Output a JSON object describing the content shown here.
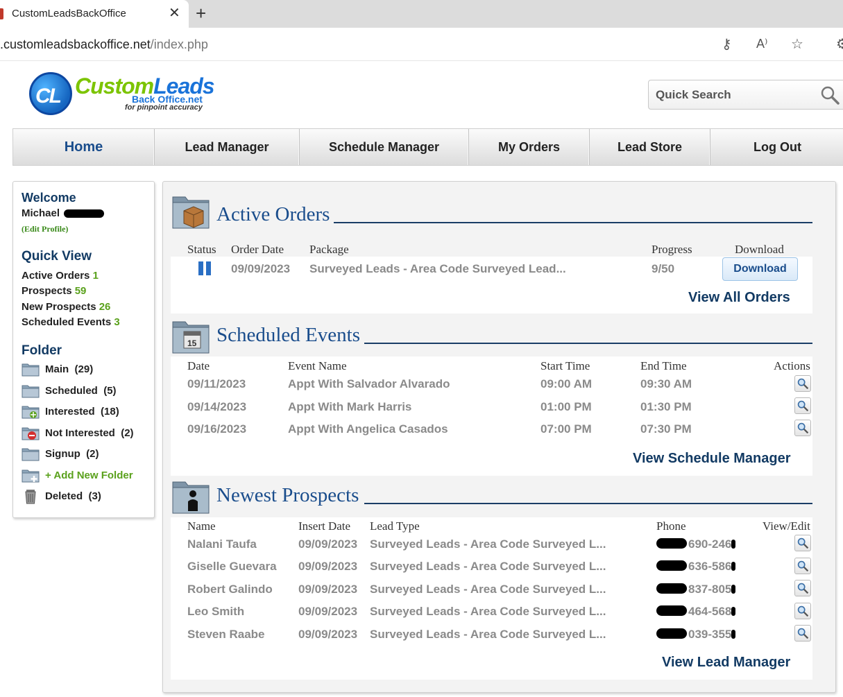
{
  "browser": {
    "tab_title": "CustomLeadsBackOffice",
    "url_host": ".customleadsbackoffice.net",
    "url_path": "/index.php"
  },
  "logo": {
    "initials": "CL",
    "name_part1": "Custom",
    "name_part2": "Leads",
    "subtitle": "Back Office.net",
    "tagline": "for pinpoint accuracy"
  },
  "search": {
    "placeholder": "Quick Search"
  },
  "nav": [
    {
      "label": "Home",
      "active": true
    },
    {
      "label": "Lead Manager"
    },
    {
      "label": "Schedule Manager"
    },
    {
      "label": "My Orders"
    },
    {
      "label": "Lead Store"
    },
    {
      "label": "Log Out"
    }
  ],
  "sidebar": {
    "welcome_heading": "Welcome",
    "user_name": "Michael",
    "edit_profile": "(Edit Profile)",
    "quick_view_heading": "Quick View",
    "quick_view": [
      {
        "label": "Active Orders",
        "count": "1"
      },
      {
        "label": "Prospects",
        "count": "59"
      },
      {
        "label": "New Prospects",
        "count": "26"
      },
      {
        "label": "Scheduled Events",
        "count": "3"
      }
    ],
    "folder_heading": "Folder",
    "folders": [
      {
        "label": "Main",
        "count": "(29)",
        "icon": "folder-icon"
      },
      {
        "label": "Scheduled",
        "count": "(5)",
        "icon": "folder-icon"
      },
      {
        "label": "Interested",
        "count": "(18)",
        "icon": "folder-interested-icon"
      },
      {
        "label": "Not Interested",
        "count": "(2)",
        "icon": "folder-not-interested-icon"
      },
      {
        "label": "Signup",
        "count": "(2)",
        "icon": "folder-icon"
      },
      {
        "label": "+ Add New Folder",
        "count": "",
        "icon": "folder-add-icon"
      },
      {
        "label": "Deleted",
        "count": "(3)",
        "icon": "trash-icon"
      }
    ]
  },
  "active_orders": {
    "title": "Active Orders",
    "headers": [
      "Status",
      "Order Date",
      "Package",
      "Progress",
      "Download"
    ],
    "rows": [
      {
        "status_icon": "pause-icon",
        "order_date": "09/09/2023",
        "package": "Surveyed Leads - Area Code Surveyed Lead...",
        "progress": "9/50",
        "download_label": "Download"
      }
    ],
    "view_all": "View All Orders"
  },
  "scheduled_events": {
    "title": "Scheduled Events",
    "headers": [
      "Date",
      "Event Name",
      "Start Time",
      "End Time",
      "Actions"
    ],
    "rows": [
      {
        "date": "09/11/2023",
        "event": "Appt With Salvador Alvarado",
        "start": "09:00 AM",
        "end": "09:30 AM"
      },
      {
        "date": "09/14/2023",
        "event": "Appt With Mark Harris",
        "start": "01:00 PM",
        "end": "01:30 PM"
      },
      {
        "date": "09/16/2023",
        "event": "Appt With Angelica Casados",
        "start": "07:00 PM",
        "end": "07:30 PM"
      }
    ],
    "view_all": "View Schedule Manager"
  },
  "newest_prospects": {
    "title": "Newest Prospects",
    "headers": [
      "Name",
      "Insert Date",
      "Lead Type",
      "Phone",
      "View/Edit"
    ],
    "rows": [
      {
        "name": "Nalani Taufa",
        "date": "09/09/2023",
        "lead_type": "Surveyed Leads - Area Code Surveyed L...",
        "phone": "690-246"
      },
      {
        "name": "Giselle Guevara",
        "date": "09/09/2023",
        "lead_type": "Surveyed Leads - Area Code Surveyed L...",
        "phone": "636-586"
      },
      {
        "name": "Robert Galindo",
        "date": "09/09/2023",
        "lead_type": "Surveyed Leads - Area Code Surveyed L...",
        "phone": "837-805"
      },
      {
        "name": "Leo Smith",
        "date": "09/09/2023",
        "lead_type": "Surveyed Leads - Area Code Surveyed L...",
        "phone": "464-568"
      },
      {
        "name": "Steven Raabe",
        "date": "09/09/2023",
        "lead_type": "Surveyed Leads - Area Code Surveyed L...",
        "phone": "039-355"
      }
    ],
    "view_all": "View Lead Manager"
  },
  "colors": {
    "heading_navy": "#123a63",
    "link_blue": "#1a4d8c",
    "count_green": "#5aa11c",
    "muted_gray": "#8a8a8a"
  }
}
